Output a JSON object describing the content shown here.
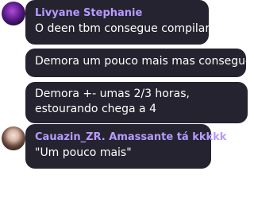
{
  "messages": [
    {
      "author": "Livyane Stephanie",
      "avatar_icon": "purple-glow-avatar-icon",
      "text": "O deen tbm consegue compilar"
    },
    {
      "text": "Demora um pouco mais mas consegue"
    },
    {
      "text": "Demora +- umas 2/3 horas, estourando chega a 4"
    },
    {
      "author": "Cauazin_ZR. Amassante tá kkkkk",
      "avatar_icon": "user-photo-avatar-icon",
      "text": "\"Um pouco mais\""
    }
  ],
  "colors": {
    "bubble_bg": "#24232f",
    "author_name": "#b79bff",
    "message_text": "#ffffff",
    "page_bg": "#ffffff"
  }
}
